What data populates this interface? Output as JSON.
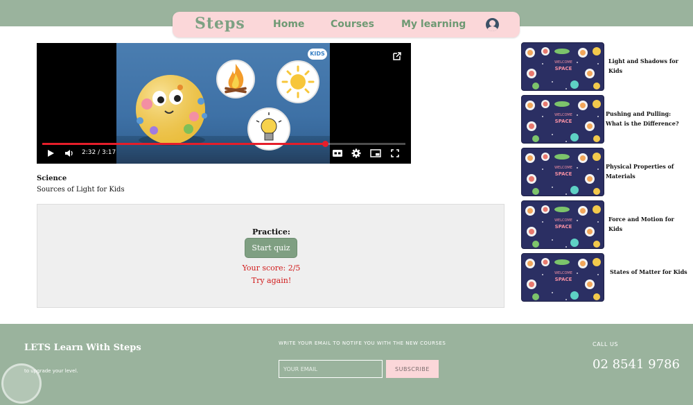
{
  "header": {
    "brand": "Steps",
    "nav": [
      "Home",
      "Courses",
      "My learning"
    ],
    "avatar_icon": "user-avatar-icon"
  },
  "player": {
    "time": "2:32 / 3:17",
    "progress_fraction": 0.778,
    "badge": "KIDS",
    "icons": [
      "play-icon",
      "volume-icon",
      "captions-icon",
      "settings-icon",
      "miniplayer-icon",
      "fullscreen-icon",
      "popout-icon"
    ]
  },
  "lesson": {
    "subject": "Science",
    "title": "Sources of Light for Kids"
  },
  "practice": {
    "label": "Practice:",
    "button": "Start quiz",
    "score": "Your score: 2/5",
    "retry": "Try again!"
  },
  "courses": [
    {
      "title": "Light and Shadows for Kids",
      "thumb_text": "WELCOME SPACE"
    },
    {
      "title": "Pushing and Pulling: What is the Difference?",
      "thumb_text": "WELCOME SPACE"
    },
    {
      "title": "Physical Properties of Materials",
      "thumb_text": "WELCOME SPACE"
    },
    {
      "title": "Force and Motion for Kids",
      "thumb_text": "WELCOME SPACE"
    },
    {
      "title": "States of Matter for Kids",
      "thumb_text": "WELCOME SPACE"
    }
  ],
  "footer": {
    "brand": "LETS Learn With Steps",
    "sub": "to upgrade your level.",
    "notify": "WRITE YOUR EMAIL TO NOTIFE YOU WITH THE NEW COURSES",
    "email_placeholder": "YOUR EMAIL",
    "subscribe": "SUBSCRIBE",
    "call_label": "CALL US",
    "phone": "02 8541 9786"
  },
  "colors": {
    "accent_green": "#9ab39d",
    "nav_pink": "#fbd7d9",
    "progress_red": "#e61e2a",
    "error_red": "#d11a1a"
  }
}
